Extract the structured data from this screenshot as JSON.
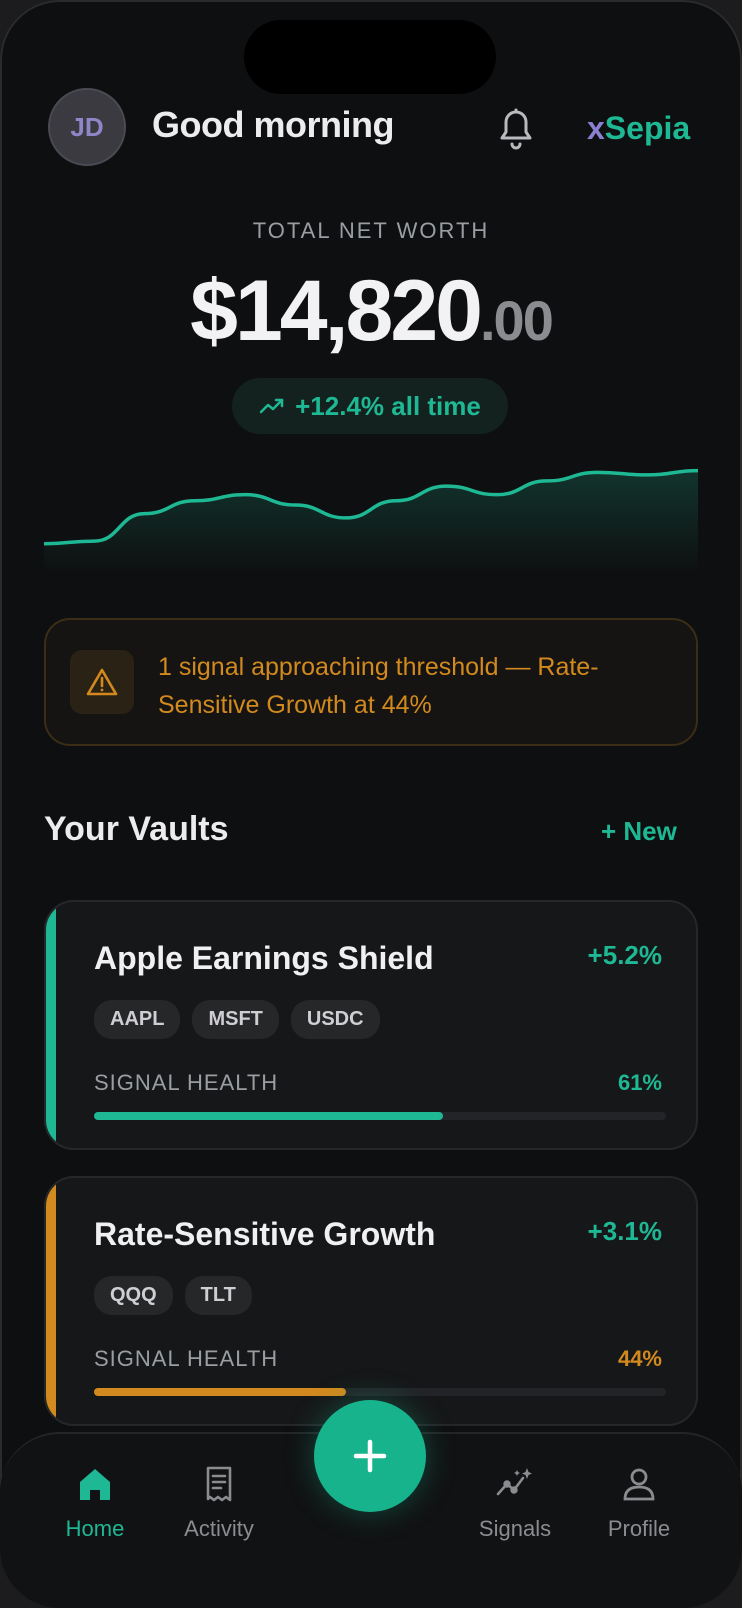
{
  "header": {
    "avatar_initials": "JD",
    "greeting": "Good morning",
    "brand_prefix": "x",
    "brand_rest": "Sepia",
    "notification_icon": "bell-icon"
  },
  "net_worth": {
    "label": "TOTAL NET WORTH",
    "value_integer": "$14,820",
    "value_decimal": ".00",
    "change_label": "+12.4% all time",
    "change_icon": "trending-up-icon",
    "sparkline_values": [
      0.05,
      0.08,
      0.4,
      0.55,
      0.62,
      0.5,
      0.35,
      0.55,
      0.72,
      0.62,
      0.78,
      0.88,
      0.85,
      0.9
    ]
  },
  "alert": {
    "icon": "warning-icon",
    "text": "1 signal approaching threshold — Rate-Sensitive Growth at 44%"
  },
  "vaults": {
    "title": "Your Vaults",
    "new_label": "+ New",
    "items": [
      {
        "name": "Apple Earnings Shield",
        "change": "+5.2%",
        "tags": [
          "AAPL",
          "MSFT",
          "USDC"
        ],
        "health_label": "SIGNAL HEALTH",
        "health_value": "61%",
        "health_fraction": 0.61,
        "accent": "#1fb894"
      },
      {
        "name": "Rate-Sensitive Growth",
        "change": "+3.1%",
        "tags": [
          "QQQ",
          "TLT"
        ],
        "health_label": "SIGNAL HEALTH",
        "health_value": "44%",
        "health_fraction": 0.44,
        "accent": "#d28a1e"
      }
    ]
  },
  "tabbar": {
    "items": [
      {
        "label": "Home",
        "icon": "home-icon",
        "active": true
      },
      {
        "label": "Activity",
        "icon": "receipt-icon",
        "active": false
      },
      {
        "label": "Signals",
        "icon": "signals-icon",
        "active": false
      },
      {
        "label": "Profile",
        "icon": "user-icon",
        "active": false
      }
    ],
    "fab_icon": "plus-icon"
  },
  "colors": {
    "accent": "#1fb894",
    "warning": "#d28a1e",
    "background": "#0e0f10"
  }
}
